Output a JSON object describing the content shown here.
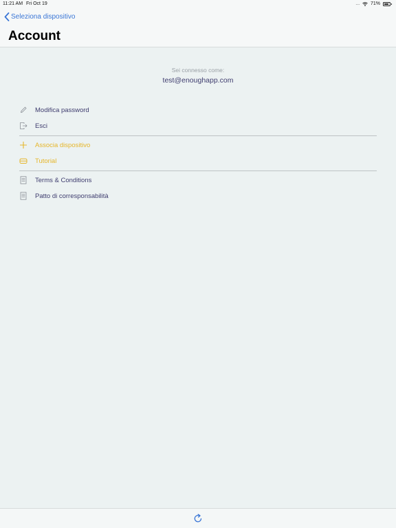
{
  "status_bar": {
    "time": "11:21 AM",
    "date": "Fri Oct 19",
    "battery": "71%",
    "battery_level": 0.71
  },
  "nav": {
    "back_label": "Seleziona dispositivo",
    "title": "Account"
  },
  "account": {
    "connected_label": "Sei connesso come:",
    "email": "test@enoughapp.com"
  },
  "menu": {
    "change_password": "Modifica password",
    "logout": "Esci",
    "pair_device": "Associa dispositivo",
    "tutorial": "Tutorial",
    "terms": "Terms & Conditions",
    "agreement": "Patto di corresponsabilità"
  },
  "colors": {
    "accent_blue": "#3a76d6",
    "text_dark": "#3e3c6e",
    "accent_yellow": "#e6b62a",
    "background": "#ecf2f2"
  },
  "icons": {
    "back": "chevron-left-icon",
    "change_password": "pencil-icon",
    "logout": "logout-icon",
    "pair_device": "plus-icon",
    "tutorial": "tutorial-icon",
    "terms": "document-icon",
    "agreement": "document-icon",
    "refresh": "refresh-icon"
  }
}
